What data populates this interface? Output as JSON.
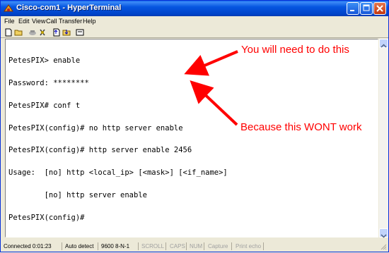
{
  "window": {
    "title": "Cisco-com1 - HyperTerminal"
  },
  "menu": {
    "items": [
      "File",
      "Edit",
      "View",
      "Call",
      "Transfer",
      "Help"
    ]
  },
  "toolbar": {
    "icons": [
      "new-icon",
      "open-icon",
      "connect-icon",
      "disconnect-icon",
      "send-icon",
      "receive-icon",
      "properties-icon"
    ]
  },
  "terminal": {
    "lines": [
      "PetesPIX> enable",
      "Password: ********",
      "PetesPIX# conf t",
      "PetesPIX(config)# no http server enable",
      "PetesPIX(config)# http server enable 2456",
      "Usage:  [no] http <local_ip> [<mask>] [<if_name>]",
      "        [no] http server enable",
      "PetesPIX(config)#"
    ]
  },
  "annotations": {
    "top": "You will need to do this",
    "bottom": "Because this WONT work",
    "color": "#ff0000"
  },
  "status": {
    "connected": "Connected 0:01:23",
    "detect": "Auto detect",
    "settings": "9600 8-N-1",
    "scroll": "SCROLL",
    "caps": "CAPS",
    "num": "NUM",
    "capture": "Capture",
    "print_echo": "Print echo"
  }
}
